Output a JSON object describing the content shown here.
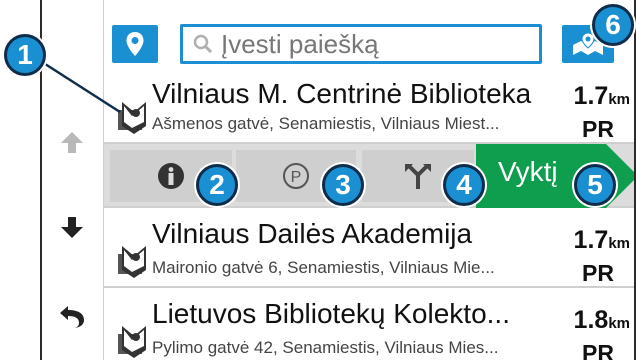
{
  "search": {
    "placeholder": "Įvesti paiešką"
  },
  "results": [
    {
      "name": "Vilniaus M. Centrinė Biblioteka",
      "address": "Ašmenos gatvė, Senamiestis, Vilniaus Miest...",
      "distance": "1.7",
      "unit": "km",
      "direction": "PR"
    },
    {
      "name": "Vilniaus Dailės Akademija",
      "address": "Maironio gatvė 6, Senamiestis, Vilniaus Mie...",
      "distance": "1.7",
      "unit": "km",
      "direction": "PR"
    },
    {
      "name": "Lietuvos Bibliotekų Kolekto...",
      "address": "Pylimo gatvė 42, Senamiestis, Vilniaus Mies...",
      "distance": "1.8",
      "unit": "km",
      "direction": "PR"
    }
  ],
  "actions": {
    "go_label": "Vyktį"
  },
  "callouts": [
    "1",
    "2",
    "3",
    "4",
    "5",
    "6"
  ],
  "colors": {
    "accent": "#1a8fd1",
    "go": "#0e9e4d",
    "callout_border": "#0e2d4a"
  }
}
